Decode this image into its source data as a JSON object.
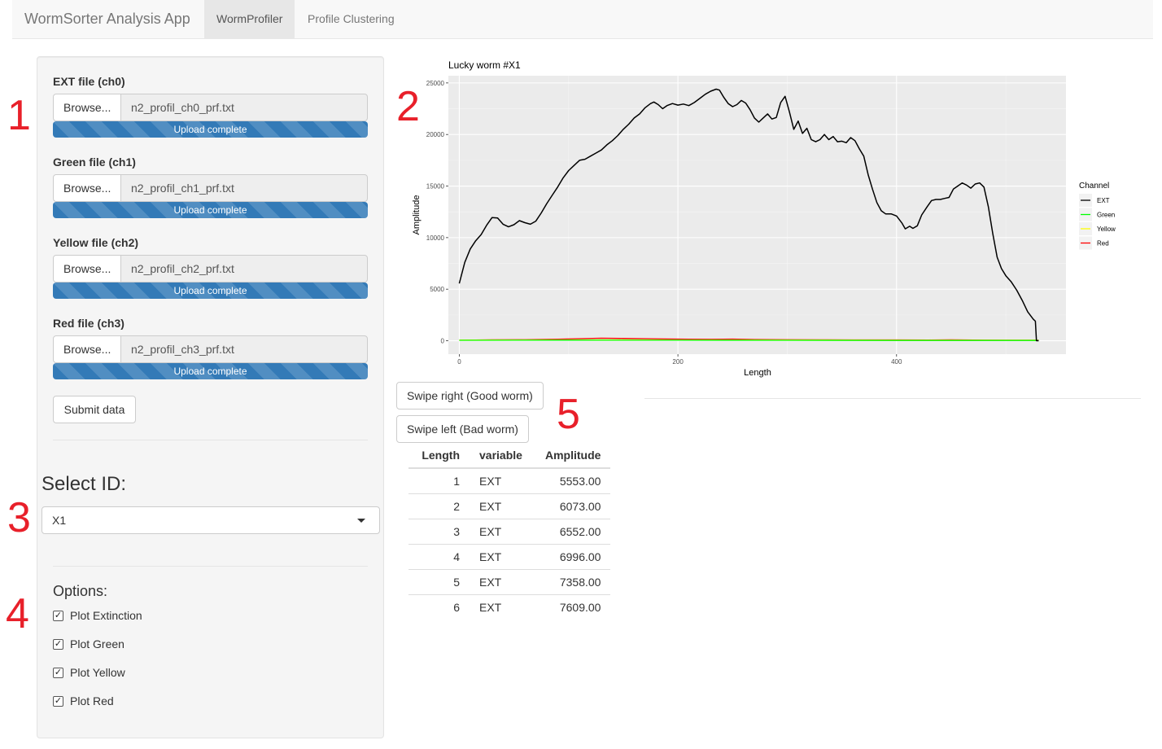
{
  "navbar": {
    "brand": "WormSorter Analysis App",
    "tabs": [
      {
        "label": "WormProfiler",
        "active": true
      },
      {
        "label": "Profile Clustering",
        "active": false
      }
    ]
  },
  "sidebar": {
    "files": [
      {
        "label": "EXT file (ch0)",
        "browse": "Browse...",
        "filename": "n2_profil_ch0_prf.txt",
        "progress": "Upload complete",
        "progress_fraction": 1.0
      },
      {
        "label": "Green file (ch1)",
        "browse": "Browse...",
        "filename": "n2_profil_ch1_prf.txt",
        "progress": "Upload complete",
        "progress_fraction": 1.0
      },
      {
        "label": "Yellow file (ch2)",
        "browse": "Browse...",
        "filename": "n2_profil_ch2_prf.txt",
        "progress": "Upload complete",
        "progress_fraction": 1.0
      },
      {
        "label": "Red file (ch3)",
        "browse": "Browse...",
        "filename": "n2_profil_ch3_prf.txt",
        "progress": "Upload complete",
        "progress_fraction": 1.0
      }
    ],
    "submit_label": "Submit data",
    "select_label": "Select ID:",
    "select_value": "X1",
    "options_label": "Options:",
    "options": [
      {
        "label": "Plot Extinction",
        "checked": true
      },
      {
        "label": "Plot Green",
        "checked": true
      },
      {
        "label": "Plot Yellow",
        "checked": true
      },
      {
        "label": "Plot Red",
        "checked": true
      }
    ]
  },
  "annotations": [
    "1",
    "2",
    "3",
    "4",
    "5"
  ],
  "chart_data": {
    "type": "line",
    "title": "Lucky worm #X1",
    "xlabel": "Length",
    "ylabel": "Amplitude",
    "xlim": [
      -10,
      555
    ],
    "ylim": [
      -1300,
      25700
    ],
    "xticks": [
      0,
      200,
      400
    ],
    "yticks": [
      0,
      5000,
      10000,
      15000,
      20000,
      25000
    ],
    "legend_title": "Channel",
    "legend_position": "right",
    "grid": true,
    "background": "#ebebeb",
    "series": [
      {
        "name": "EXT",
        "color": "#000000",
        "points": [
          [
            0,
            5553
          ],
          [
            5,
            7609
          ],
          [
            10,
            8900
          ],
          [
            15,
            9700
          ],
          [
            20,
            10300
          ],
          [
            25,
            11200
          ],
          [
            30,
            11950
          ],
          [
            35,
            11900
          ],
          [
            40,
            11300
          ],
          [
            45,
            11050
          ],
          [
            50,
            11250
          ],
          [
            55,
            11650
          ],
          [
            60,
            11450
          ],
          [
            65,
            11300
          ],
          [
            70,
            11600
          ],
          [
            75,
            12400
          ],
          [
            80,
            13300
          ],
          [
            85,
            14100
          ],
          [
            90,
            14900
          ],
          [
            95,
            15800
          ],
          [
            100,
            16500
          ],
          [
            105,
            17000
          ],
          [
            110,
            17500
          ],
          [
            115,
            17600
          ],
          [
            120,
            17900
          ],
          [
            125,
            18200
          ],
          [
            130,
            18500
          ],
          [
            135,
            19000
          ],
          [
            140,
            19400
          ],
          [
            145,
            19900
          ],
          [
            150,
            20500
          ],
          [
            155,
            21000
          ],
          [
            160,
            21600
          ],
          [
            165,
            22000
          ],
          [
            170,
            22600
          ],
          [
            175,
            23000
          ],
          [
            178,
            23150
          ],
          [
            182,
            22900
          ],
          [
            186,
            22500
          ],
          [
            190,
            22800
          ],
          [
            195,
            23000
          ],
          [
            200,
            22850
          ],
          [
            205,
            22950
          ],
          [
            210,
            22800
          ],
          [
            215,
            23100
          ],
          [
            220,
            23500
          ],
          [
            225,
            23900
          ],
          [
            230,
            24200
          ],
          [
            235,
            24400
          ],
          [
            238,
            24300
          ],
          [
            242,
            23600
          ],
          [
            246,
            23000
          ],
          [
            250,
            22700
          ],
          [
            254,
            22900
          ],
          [
            258,
            23300
          ],
          [
            262,
            23050
          ],
          [
            266,
            22400
          ],
          [
            270,
            21600
          ],
          [
            274,
            21200
          ],
          [
            278,
            21600
          ],
          [
            282,
            22000
          ],
          [
            286,
            21500
          ],
          [
            290,
            21650
          ],
          [
            294,
            23100
          ],
          [
            298,
            23700
          ],
          [
            302,
            22200
          ],
          [
            306,
            20500
          ],
          [
            310,
            21300
          ],
          [
            314,
            20100
          ],
          [
            318,
            20600
          ],
          [
            322,
            19500
          ],
          [
            326,
            19300
          ],
          [
            330,
            19500
          ],
          [
            334,
            20000
          ],
          [
            338,
            19500
          ],
          [
            342,
            19800
          ],
          [
            346,
            19300
          ],
          [
            350,
            19350
          ],
          [
            354,
            19200
          ],
          [
            358,
            19700
          ],
          [
            362,
            19400
          ],
          [
            366,
            18600
          ],
          [
            370,
            17900
          ],
          [
            374,
            16100
          ],
          [
            378,
            14700
          ],
          [
            382,
            13400
          ],
          [
            386,
            12600
          ],
          [
            390,
            12300
          ],
          [
            395,
            12300
          ],
          [
            400,
            12100
          ],
          [
            405,
            11400
          ],
          [
            408,
            10850
          ],
          [
            412,
            11100
          ],
          [
            415,
            10900
          ],
          [
            419,
            11150
          ],
          [
            423,
            12200
          ],
          [
            428,
            13000
          ],
          [
            432,
            13600
          ],
          [
            436,
            13700
          ],
          [
            440,
            13700
          ],
          [
            444,
            13800
          ],
          [
            448,
            13900
          ],
          [
            452,
            14700
          ],
          [
            456,
            15000
          ],
          [
            460,
            15300
          ],
          [
            464,
            15100
          ],
          [
            468,
            14800
          ],
          [
            472,
            15200
          ],
          [
            476,
            15300
          ],
          [
            480,
            14900
          ],
          [
            484,
            13000
          ],
          [
            488,
            10400
          ],
          [
            492,
            8100
          ],
          [
            496,
            7000
          ],
          [
            500,
            6300
          ],
          [
            505,
            5700
          ],
          [
            510,
            4900
          ],
          [
            515,
            3900
          ],
          [
            520,
            2800
          ],
          [
            525,
            2100
          ],
          [
            527,
            1900
          ],
          [
            528,
            0
          ],
          [
            530,
            0
          ]
        ]
      },
      {
        "name": "Green",
        "color": "#00ff00",
        "points": [
          [
            0,
            40
          ],
          [
            100,
            60
          ],
          [
            200,
            50
          ],
          [
            300,
            40
          ],
          [
            400,
            30
          ],
          [
            500,
            30
          ],
          [
            530,
            30
          ]
        ]
      },
      {
        "name": "Yellow",
        "color": "#ffff00",
        "points": [
          [
            0,
            60
          ],
          [
            100,
            80
          ],
          [
            200,
            70
          ],
          [
            300,
            60
          ],
          [
            400,
            50
          ],
          [
            500,
            50
          ],
          [
            530,
            50
          ]
        ]
      },
      {
        "name": "Red",
        "color": "#ff0000",
        "points": [
          [
            0,
            50
          ],
          [
            30,
            90
          ],
          [
            60,
            100
          ],
          [
            90,
            150
          ],
          [
            110,
            200
          ],
          [
            130,
            250
          ],
          [
            150,
            220
          ],
          [
            170,
            200
          ],
          [
            190,
            170
          ],
          [
            210,
            150
          ],
          [
            230,
            140
          ],
          [
            250,
            160
          ],
          [
            270,
            120
          ],
          [
            300,
            100
          ],
          [
            330,
            90
          ],
          [
            360,
            80
          ],
          [
            400,
            80
          ],
          [
            430,
            70
          ],
          [
            450,
            90
          ],
          [
            480,
            60
          ],
          [
            510,
            50
          ],
          [
            530,
            50
          ]
        ]
      }
    ]
  },
  "actions": {
    "swipe_right": "Swipe right (Good worm)",
    "swipe_left": "Swipe left (Bad worm)"
  },
  "table": {
    "headers": [
      "Length",
      "variable",
      "Amplitude"
    ],
    "rows": [
      [
        "1",
        "EXT",
        "5553.00"
      ],
      [
        "2",
        "EXT",
        "6073.00"
      ],
      [
        "3",
        "EXT",
        "6552.00"
      ],
      [
        "4",
        "EXT",
        "6996.00"
      ],
      [
        "5",
        "EXT",
        "7358.00"
      ],
      [
        "6",
        "EXT",
        "7609.00"
      ]
    ]
  }
}
